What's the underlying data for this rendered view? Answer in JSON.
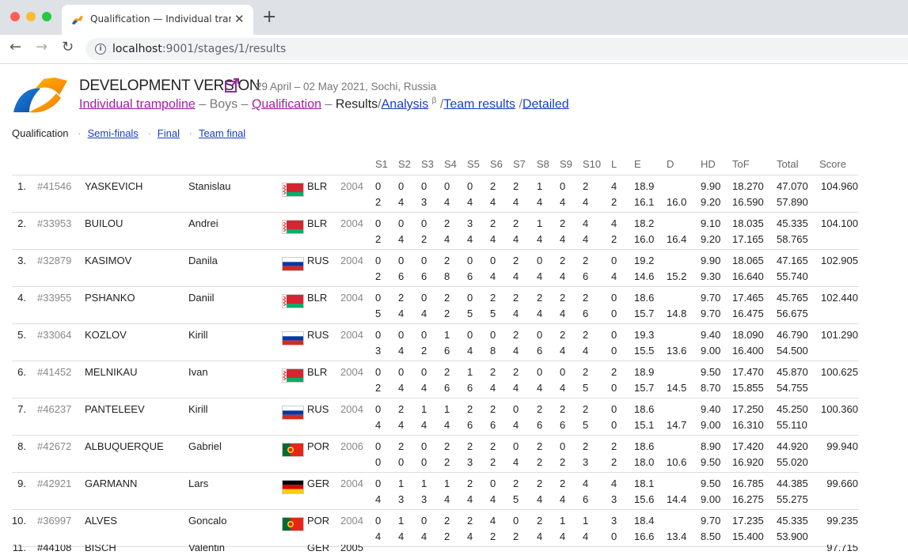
{
  "browser": {
    "tab_title": "Qualification — Individual tramp",
    "url_host": "localhost",
    "url_path": ":9001/stages/1/results"
  },
  "header": {
    "title": "DEVELOPMENT VERSION",
    "dates": "29 April – 02 May 2021, Sochi, Russia",
    "breadcrumb": {
      "discipline": "Individual trampoline",
      "category": "Boys",
      "stage": "Qualification",
      "results": "Results",
      "analysis": "Analysis",
      "analysis_sup": "β",
      "team_results": "Team results",
      "detailed": "Detailed",
      "dash": "–",
      "slash": "/"
    }
  },
  "stages": {
    "current": "Qualification",
    "links": [
      "Semi-finals",
      "Final",
      "Team final"
    ],
    "sep": "·"
  },
  "columns": [
    "S1",
    "S2",
    "S3",
    "S4",
    "S5",
    "S6",
    "S7",
    "S8",
    "S9",
    "S10",
    "L",
    "E",
    "D",
    "HD",
    "ToF",
    "Total",
    "Score"
  ],
  "rows": [
    {
      "rank": "1.",
      "id": "#41546",
      "last": "YASKEVICH",
      "first": "Stanislau",
      "country": "BLR",
      "year": "2004",
      "s1": [
        "0",
        "0",
        "0",
        "0",
        "0",
        "2",
        "2",
        "1",
        "0",
        "2",
        "4"
      ],
      "s2": [
        "2",
        "4",
        "3",
        "4",
        "4",
        "4",
        "4",
        "4",
        "4",
        "4",
        "2"
      ],
      "e1": "18.9",
      "e2": "16.1",
      "d2": "16.0",
      "hd1": "9.90",
      "hd2": "9.20",
      "tof1": "18.270",
      "tof2": "16.590",
      "tot1": "47.070",
      "tot2": "57.890",
      "score": "104.960"
    },
    {
      "rank": "2.",
      "id": "#33953",
      "last": "BUILOU",
      "first": "Andrei",
      "country": "BLR",
      "year": "2004",
      "s1": [
        "0",
        "0",
        "0",
        "2",
        "3",
        "2",
        "2",
        "1",
        "2",
        "4",
        "4"
      ],
      "s2": [
        "2",
        "4",
        "2",
        "4",
        "4",
        "4",
        "4",
        "4",
        "4",
        "4",
        "2"
      ],
      "e1": "18.2",
      "e2": "16.0",
      "d2": "16.4",
      "hd1": "9.10",
      "hd2": "9.20",
      "tof1": "18.035",
      "tof2": "17.165",
      "tot1": "45.335",
      "tot2": "58.765",
      "score": "104.100"
    },
    {
      "rank": "3.",
      "id": "#32879",
      "last": "KASIMOV",
      "first": "Danila",
      "country": "RUS",
      "year": "2004",
      "s1": [
        "0",
        "0",
        "0",
        "2",
        "0",
        "0",
        "2",
        "0",
        "2",
        "2",
        "0"
      ],
      "s2": [
        "2",
        "6",
        "6",
        "8",
        "6",
        "4",
        "4",
        "4",
        "4",
        "6",
        "4"
      ],
      "e1": "19.2",
      "e2": "14.6",
      "d2": "15.2",
      "hd1": "9.90",
      "hd2": "9.30",
      "tof1": "18.065",
      "tof2": "16.640",
      "tot1": "47.165",
      "tot2": "55.740",
      "score": "102.905"
    },
    {
      "rank": "4.",
      "id": "#33955",
      "last": "PSHANKO",
      "first": "Daniil",
      "country": "BLR",
      "year": "2004",
      "s1": [
        "0",
        "2",
        "0",
        "2",
        "0",
        "2",
        "2",
        "2",
        "2",
        "2",
        "0"
      ],
      "s2": [
        "5",
        "4",
        "4",
        "2",
        "5",
        "5",
        "4",
        "4",
        "4",
        "6",
        "0"
      ],
      "e1": "18.6",
      "e2": "15.7",
      "d2": "14.8",
      "hd1": "9.70",
      "hd2": "9.70",
      "tof1": "17.465",
      "tof2": "16.475",
      "tot1": "45.765",
      "tot2": "56.675",
      "score": "102.440"
    },
    {
      "rank": "5.",
      "id": "#33064",
      "last": "KOZLOV",
      "first": "Kirill",
      "country": "RUS",
      "year": "2004",
      "s1": [
        "0",
        "0",
        "0",
        "1",
        "0",
        "0",
        "2",
        "0",
        "2",
        "2",
        "0"
      ],
      "s2": [
        "3",
        "4",
        "2",
        "6",
        "4",
        "8",
        "4",
        "6",
        "4",
        "4",
        "0"
      ],
      "e1": "19.3",
      "e2": "15.5",
      "d2": "13.6",
      "hd1": "9.40",
      "hd2": "9.00",
      "tof1": "18.090",
      "tof2": "16.400",
      "tot1": "46.790",
      "tot2": "54.500",
      "score": "101.290"
    },
    {
      "rank": "6.",
      "id": "#41452",
      "last": "MELNIKAU",
      "first": "Ivan",
      "country": "BLR",
      "year": "2004",
      "s1": [
        "0",
        "0",
        "0",
        "2",
        "1",
        "2",
        "2",
        "0",
        "0",
        "2",
        "2"
      ],
      "s2": [
        "2",
        "4",
        "4",
        "6",
        "6",
        "4",
        "4",
        "4",
        "4",
        "5",
        "0"
      ],
      "e1": "18.9",
      "e2": "15.7",
      "d2": "14.5",
      "hd1": "9.50",
      "hd2": "8.70",
      "tof1": "17.470",
      "tof2": "15.855",
      "tot1": "45.870",
      "tot2": "54.755",
      "score": "100.625"
    },
    {
      "rank": "7.",
      "id": "#46237",
      "last": "PANTELEEV",
      "first": "Kirill",
      "country": "RUS",
      "year": "2004",
      "s1": [
        "0",
        "2",
        "1",
        "1",
        "2",
        "2",
        "0",
        "2",
        "2",
        "2",
        "0"
      ],
      "s2": [
        "4",
        "4",
        "4",
        "4",
        "6",
        "6",
        "4",
        "6",
        "6",
        "5",
        "0"
      ],
      "e1": "18.6",
      "e2": "15.1",
      "d2": "14.7",
      "hd1": "9.40",
      "hd2": "9.00",
      "tof1": "17.250",
      "tof2": "16.310",
      "tot1": "45.250",
      "tot2": "55.110",
      "score": "100.360"
    },
    {
      "rank": "8.",
      "id": "#42672",
      "last": "ALBUQUERQUE",
      "first": "Gabriel",
      "country": "POR",
      "year": "2006",
      "s1": [
        "0",
        "2",
        "0",
        "2",
        "2",
        "2",
        "0",
        "2",
        "0",
        "2",
        "2"
      ],
      "s2": [
        "0",
        "0",
        "0",
        "2",
        "3",
        "2",
        "4",
        "2",
        "2",
        "3",
        "2"
      ],
      "e1": "18.6",
      "e2": "18.0",
      "d2": "10.6",
      "hd1": "8.90",
      "hd2": "9.50",
      "tof1": "17.420",
      "tof2": "16.920",
      "tot1": "44.920",
      "tot2": "55.020",
      "score": "99.940"
    },
    {
      "rank": "9.",
      "id": "#42921",
      "last": "GARMANN",
      "first": "Lars",
      "country": "GER",
      "year": "2004",
      "s1": [
        "0",
        "1",
        "1",
        "1",
        "2",
        "0",
        "2",
        "2",
        "2",
        "4",
        "4"
      ],
      "s2": [
        "4",
        "3",
        "3",
        "4",
        "4",
        "4",
        "5",
        "4",
        "4",
        "6",
        "3"
      ],
      "e1": "18.1",
      "e2": "15.6",
      "d2": "14.4",
      "hd1": "9.50",
      "hd2": "9.00",
      "tof1": "16.785",
      "tof2": "16.275",
      "tot1": "44.385",
      "tot2": "55.275",
      "score": "99.660"
    },
    {
      "rank": "10.",
      "id": "#36997",
      "last": "ALVES",
      "first": "Goncalo",
      "country": "POR",
      "year": "2004",
      "s1": [
        "0",
        "1",
        "0",
        "2",
        "2",
        "4",
        "0",
        "2",
        "1",
        "1",
        "3"
      ],
      "s2": [
        "4",
        "4",
        "4",
        "2",
        "4",
        "2",
        "2",
        "4",
        "4",
        "4",
        "0"
      ],
      "e1": "18.4",
      "e2": "16.6",
      "d2": "13.4",
      "hd1": "9.70",
      "hd2": "8.50",
      "tof1": "17.235",
      "tof2": "15.400",
      "tot1": "45.335",
      "tot2": "53.900",
      "score": "99.235"
    }
  ],
  "partial_row": {
    "rank": "11.",
    "id": "#44108",
    "last": "BISCH",
    "first": "Valentin",
    "country": "GER",
    "year": "2005",
    "score": "97.715"
  },
  "colors": {
    "accent_purple": "#a020a0",
    "link_blue": "#1a3fc0"
  }
}
